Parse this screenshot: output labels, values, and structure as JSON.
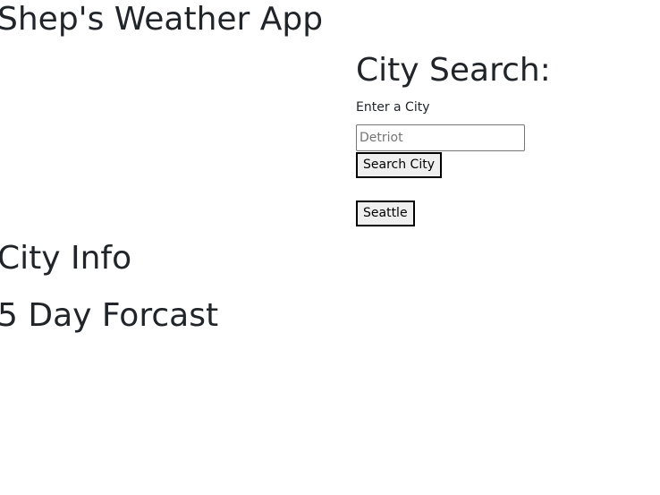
{
  "header": {
    "title": "Shep's Weather App"
  },
  "search": {
    "heading": "City Search:",
    "label": "Enter a City",
    "placeholder": "Detriot",
    "value": "",
    "button_label": "Search City",
    "history": [
      {
        "label": "Seattle"
      }
    ]
  },
  "city_info": {
    "heading": "City Info"
  },
  "forecast": {
    "heading": "5 Day Forcast"
  }
}
